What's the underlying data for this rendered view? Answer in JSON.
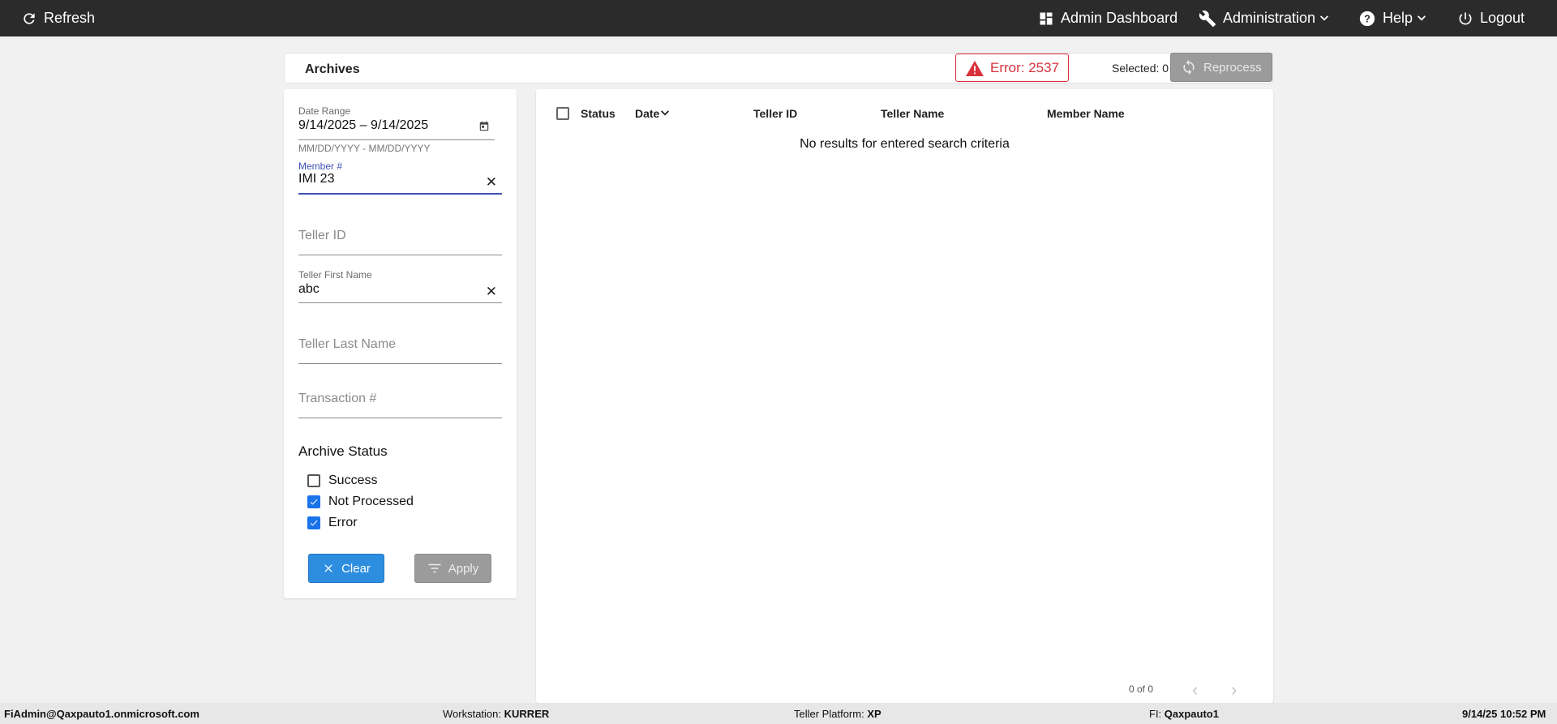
{
  "topbar": {
    "refresh": "Refresh",
    "admin_dashboard": "Admin Dashboard",
    "administration": "Administration",
    "help": "Help",
    "logout": "Logout"
  },
  "header": {
    "title": "Archives",
    "error_text": "Error: 2537",
    "selected_text": "Selected: 0",
    "reprocess": "Reprocess"
  },
  "filters": {
    "date_range_label": "Date Range",
    "date_range_value": "9/14/2025 – 9/14/2025",
    "date_hint": "MM/DD/YYYY - MM/DD/YYYY",
    "member_label": "Member #",
    "member_value": "IMI 23",
    "teller_id_placeholder": "Teller ID",
    "teller_first_label": "Teller First Name",
    "teller_first_value": "abc",
    "teller_last_placeholder": "Teller Last Name",
    "transaction_placeholder": "Transaction #",
    "archive_status_title": "Archive Status",
    "statuses": [
      {
        "label": "Success",
        "checked": false
      },
      {
        "label": "Not Processed",
        "checked": true
      },
      {
        "label": "Error",
        "checked": true
      }
    ],
    "clear": "Clear",
    "apply": "Apply"
  },
  "results": {
    "columns": [
      "Status",
      "Date",
      "Teller ID",
      "Teller Name",
      "Member Name"
    ],
    "empty_message": "No results for entered search criteria",
    "pager_text": "0 of 0"
  },
  "statusbar": {
    "user": "FiAdmin@Qaxpauto1.onmicrosoft.com",
    "workstation_label": "Workstation:",
    "workstation_value": "KURRER",
    "platform_label": "Teller Platform:",
    "platform_value": "XP",
    "fi_label": "FI:",
    "fi_value": "Qaxpauto1",
    "datetime": "9/14/25 10:52 PM"
  },
  "colors": {
    "topbar": "#2b2b2b",
    "error": "#d9303c",
    "primary_button": "#2d8ee0",
    "disabled_button": "#9b9b9b",
    "focus_underline": "#3f51b5"
  }
}
